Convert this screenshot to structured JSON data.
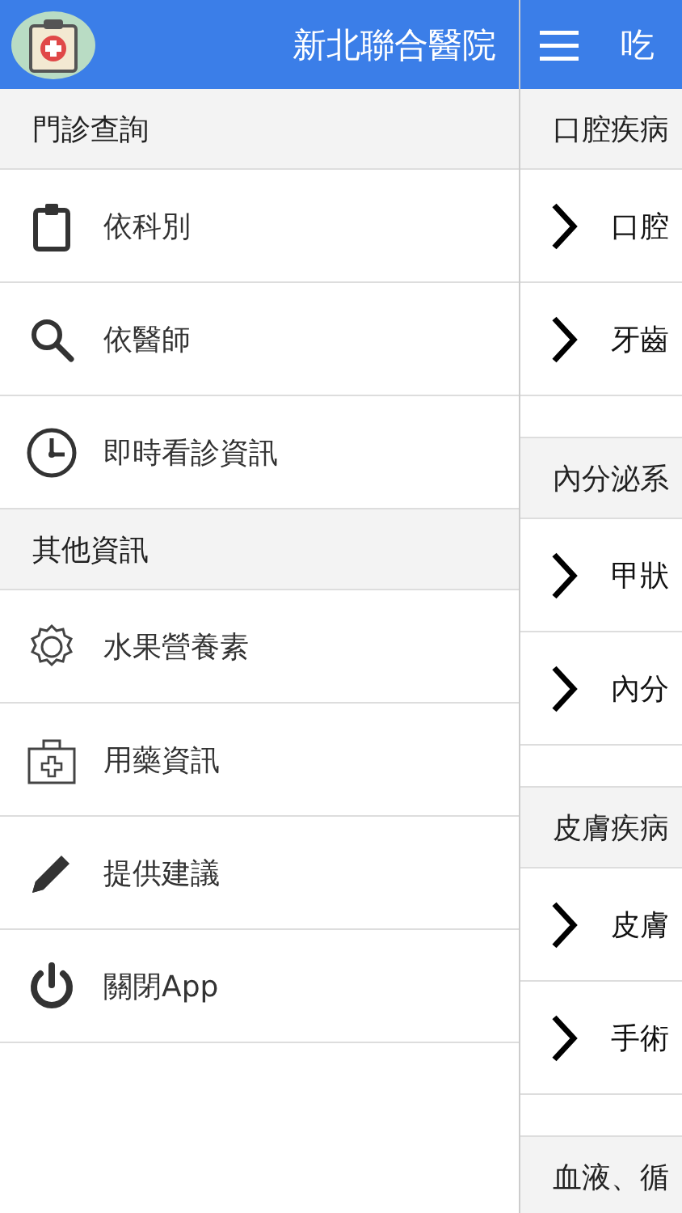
{
  "drawer": {
    "title": "新北聯合醫院",
    "sections": [
      {
        "title": "門診查詢",
        "items": [
          {
            "label": "依科別",
            "kind": "clipboard"
          },
          {
            "label": "依醫師",
            "kind": "search"
          },
          {
            "label": "即時看診資訊",
            "kind": "clock"
          }
        ]
      },
      {
        "title": "其他資訊",
        "items": [
          {
            "label": "水果營養素",
            "kind": "gear"
          },
          {
            "label": "用藥資訊",
            "kind": "kit"
          },
          {
            "label": "提供建議",
            "kind": "pencil"
          },
          {
            "label": "關閉App",
            "kind": "power"
          }
        ]
      }
    ]
  },
  "main": {
    "title": "吃",
    "sections": [
      {
        "title": "口腔疾病",
        "items": [
          "口腔",
          "牙齒"
        ]
      },
      {
        "title": "內分泌系",
        "items": [
          "甲狀",
          "內分"
        ]
      },
      {
        "title": "皮膚疾病",
        "items": [
          "皮膚",
          "手術"
        ]
      },
      {
        "title": "血液、循"
      }
    ]
  }
}
